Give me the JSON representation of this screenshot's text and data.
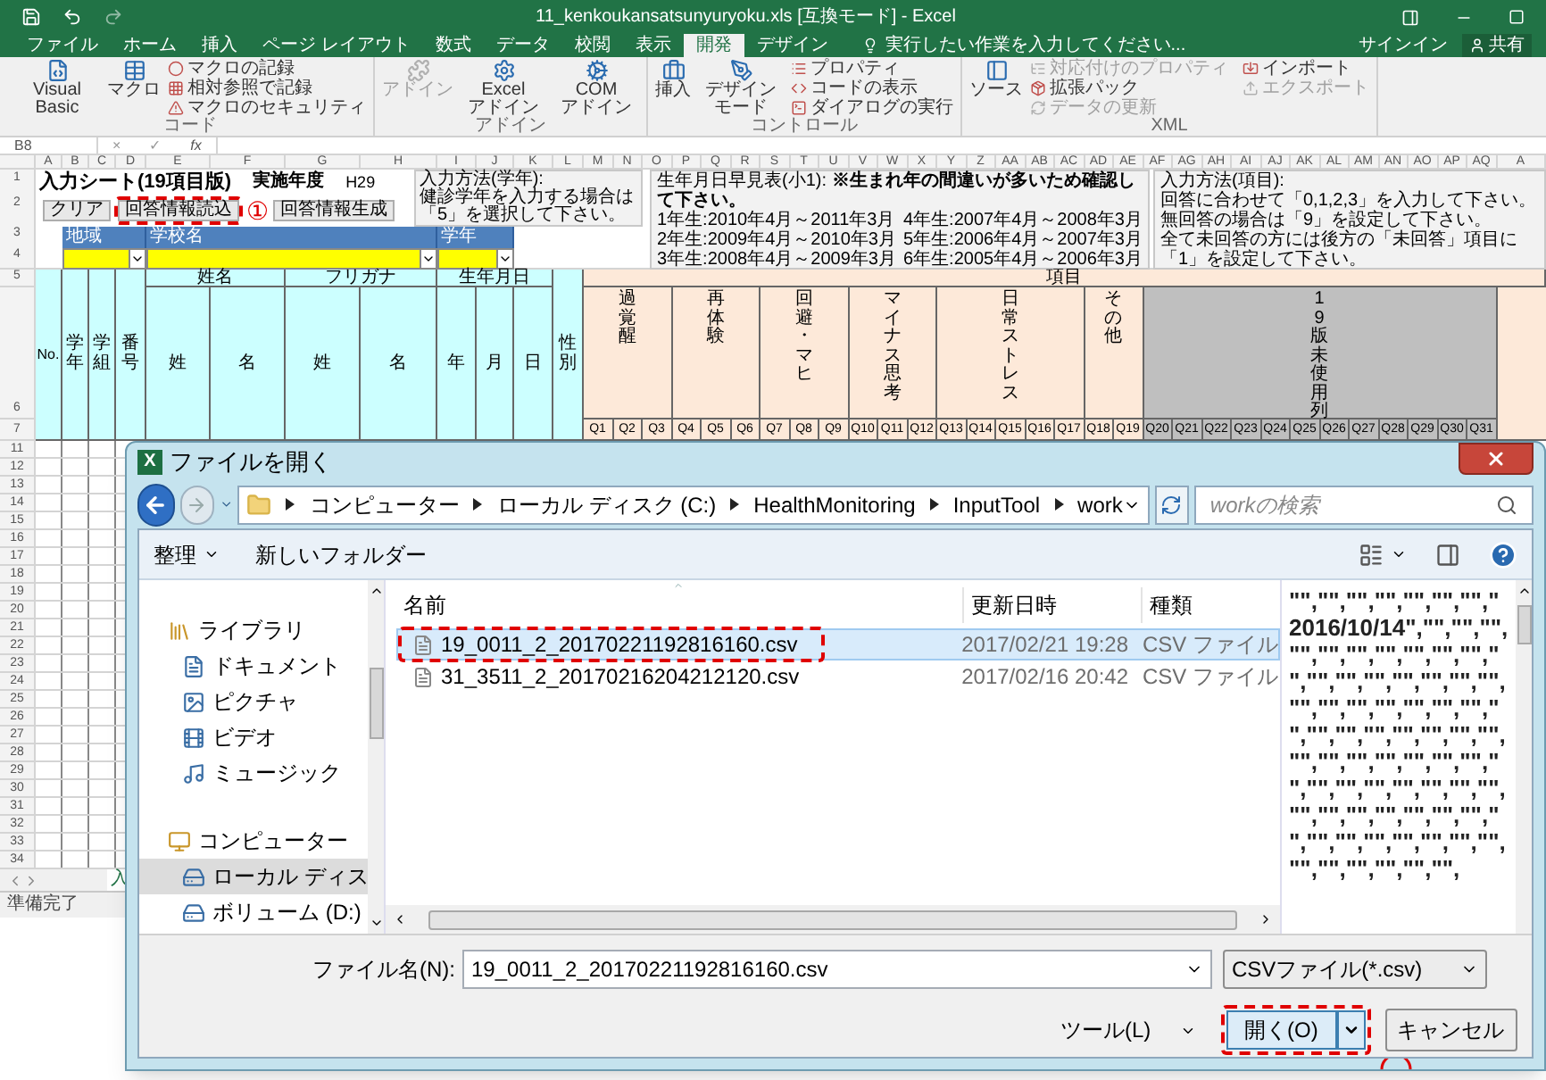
{
  "excel": {
    "title": "11_kenkoukansatsunyuryoku.xls [互換モード] - Excel",
    "tabs": [
      {
        "label": "ファイル",
        "selected": false
      },
      {
        "label": "ホーム",
        "selected": false
      },
      {
        "label": "挿入",
        "selected": false
      },
      {
        "label": "ページ レイアウト",
        "selected": false
      },
      {
        "label": "数式",
        "selected": false
      },
      {
        "label": "データ",
        "selected": false
      },
      {
        "label": "校閲",
        "selected": false
      },
      {
        "label": "表示",
        "selected": false
      },
      {
        "label": "開発",
        "selected": true
      },
      {
        "label": "デザイン",
        "selected": false
      }
    ],
    "tell_me": "実行したい作業を入力してください...",
    "sign_in": "サインイン",
    "share": "共有",
    "ribbon_groups": [
      {
        "label": "コード",
        "items": [
          {
            "kind": "large",
            "label": "Visual Basic",
            "disabled": false
          },
          {
            "kind": "large",
            "label": "マクロ",
            "disabled": false
          },
          {
            "kind": "small",
            "label": "マクロの記録",
            "disabled": false
          },
          {
            "kind": "small",
            "label": "相対参照で記録",
            "disabled": false
          },
          {
            "kind": "small",
            "label": "マクロのセキュリティ",
            "disabled": false
          }
        ]
      },
      {
        "label": "アドイン",
        "items": [
          {
            "kind": "large",
            "label": "アドイン",
            "disabled": true
          },
          {
            "kind": "large",
            "label": "Excel アドイン",
            "disabled": false
          },
          {
            "kind": "large",
            "label": "COM アドイン",
            "disabled": false
          }
        ]
      },
      {
        "label": "コントロール",
        "items": [
          {
            "kind": "large",
            "label": "挿入",
            "disabled": false
          },
          {
            "kind": "large",
            "label": "デザインモード",
            "disabled": false
          },
          {
            "kind": "small",
            "label": "プロパティ",
            "disabled": false
          },
          {
            "kind": "small",
            "label": "コードの表示",
            "disabled": false
          },
          {
            "kind": "small",
            "label": "ダイアログの実行",
            "disabled": false
          }
        ]
      },
      {
        "label": "XML",
        "items": [
          {
            "kind": "large",
            "label": "ソース",
            "disabled": false
          },
          {
            "kind": "small",
            "label": "対応付けのプロパティ",
            "disabled": true
          },
          {
            "kind": "small",
            "label": "拡張パック",
            "disabled": false
          },
          {
            "kind": "small",
            "label": "データの更新",
            "disabled": true
          },
          {
            "kind": "small",
            "label": "インポート",
            "disabled": false
          },
          {
            "kind": "small",
            "label": "エクスポート",
            "disabled": true
          }
        ]
      }
    ],
    "formula_bar": {
      "name_box": "B8",
      "cancel": "×",
      "enter": "✓",
      "function": "fx"
    },
    "columns": [
      "A",
      "B",
      "C",
      "D",
      "E",
      "F",
      "G",
      "H",
      "I",
      "J",
      "K",
      "L",
      "M",
      "N",
      "O",
      "P",
      "Q",
      "R",
      "S",
      "T",
      "U",
      "V",
      "W",
      "X",
      "Y",
      "Z",
      "AA",
      "AB",
      "AC",
      "AD",
      "AE",
      "AF",
      "AG",
      "AH",
      "AI",
      "AJ",
      "AK",
      "AL",
      "AM",
      "AN",
      "AO",
      "AP",
      "AQ",
      "A"
    ],
    "top_rows": [
      "1",
      "2",
      "3",
      "4"
    ],
    "sheet_title": "入力シート(19項目版)",
    "year_label": "実施年度",
    "year_value": "H29",
    "buttons": [
      {
        "label": "クリア",
        "highlighted": false
      },
      {
        "label": "回答情報読込",
        "highlighted": true
      },
      {
        "label": "回答情報生成",
        "highlighted": false
      }
    ],
    "step_mark": "①",
    "grade_note": [
      "入力方法(学年):",
      "健診学年を入力する場合は",
      "「5」を選択して下さい。"
    ],
    "birth_note": {
      "heading": "生年月日早見表(小1): **※生まれ年の間違いが多いため確認して下さい。**",
      "lines": [
        "1年生:2010年4月～2011年3月",
        "4年生:2007年4月～2008年3月",
        "2年生:2009年4月～2010年3月",
        "5年生:2006年4月～2007年3月",
        "3年生:2008年4月～2009年3月",
        "6年生:2005年4月～2006年3月"
      ]
    },
    "item_note": [
      "入力方法(項目):",
      "回答に合わせて「0,1,2,3」を入力して下さい。",
      "無回答の場合は「9」を設定して下さい。",
      "全て未回答の方には後方の「未回答」項目に",
      "「1」を設定して下さい。"
    ],
    "selectors": [
      {
        "label": "地域"
      },
      {
        "label": "学校名"
      },
      {
        "label": "学年"
      }
    ],
    "header_rows": [
      "5",
      "6",
      "7"
    ],
    "person_columns": [
      {
        "label": "No.",
        "kind": "horizontal"
      },
      {
        "label": "学年",
        "kind": "vertical"
      },
      {
        "label": "学組",
        "kind": "vertical"
      },
      {
        "label": "番号",
        "kind": "vertical"
      }
    ],
    "name_groups": [
      {
        "label": "姓名",
        "sub": [
          "姓",
          "名"
        ]
      },
      {
        "label": "フリガナ",
        "sub": [
          "姓",
          "名"
        ]
      },
      {
        "label": "生年月日",
        "sub": [
          "年",
          "月",
          "日"
        ]
      }
    ],
    "gender": "性別",
    "items_label": "項目",
    "item_groups": [
      {
        "label": "過覚醒",
        "unused": false,
        "questions": [
          "Q1",
          "Q2",
          "Q3"
        ]
      },
      {
        "label": "再体験",
        "unused": false,
        "questions": [
          "Q4",
          "Q5",
          "Q6"
        ]
      },
      {
        "label": "回避・マヒ",
        "unused": false,
        "questions": [
          "Q7",
          "Q8",
          "Q9"
        ]
      },
      {
        "label": "マイナス思考",
        "unused": false,
        "questions": [
          "Q10",
          "Q11",
          "Q12"
        ]
      },
      {
        "label": "日常ストレス",
        "unused": false,
        "questions": [
          "Q13",
          "Q14",
          "Q15",
          "Q16",
          "Q17"
        ]
      },
      {
        "label": "その他",
        "unused": false,
        "questions": [
          "Q18",
          "Q19"
        ]
      },
      {
        "label": "19版未使用列",
        "unused": true,
        "questions": [
          "Q20",
          "Q21",
          "Q22",
          "Q23",
          "Q24",
          "Q25",
          "Q26",
          "Q27",
          "Q28",
          "Q29",
          "Q30",
          "Q31"
        ]
      }
    ],
    "rows": [
      "11",
      "12",
      "13",
      "14",
      "15",
      "16",
      "17",
      "18",
      "19",
      "20",
      "21",
      "22",
      "23",
      "24",
      "25",
      "26",
      "27",
      "28",
      "29",
      "30",
      "31",
      "32",
      "33",
      "34"
    ],
    "sheet_tab": "入",
    "status": "準備完了"
  },
  "dialog": {
    "title": "ファイルを開く",
    "app_badge": "X",
    "path": [
      "コンピューター",
      "ローカル ディスク (C:)",
      "HealthMonitoring",
      "InputTool",
      "work"
    ],
    "search_placeholder": "workの検索",
    "organize": "整理",
    "new_folder": "新しいフォルダー",
    "nav": [
      {
        "label": "ライブラリ",
        "kind": "library",
        "selected": false,
        "children": [
          {
            "label": "ドキュメント",
            "kind": "documents",
            "selected": false
          },
          {
            "label": "ピクチャ",
            "kind": "pictures",
            "selected": false
          },
          {
            "label": "ビデオ",
            "kind": "videos",
            "selected": false
          },
          {
            "label": "ミュージック",
            "kind": "music",
            "selected": false
          }
        ]
      },
      {
        "label": "コンピューター",
        "kind": "computer",
        "selected": false,
        "children": [
          {
            "label": "ローカル ディス",
            "kind": "disk",
            "selected": true
          },
          {
            "label": "ボリューム (D:)",
            "kind": "drive",
            "selected": false
          }
        ]
      }
    ],
    "columns": [
      "名前",
      "更新日時",
      "種類"
    ],
    "files": [
      {
        "name": "19_0011_2_20170221192816160.csv",
        "modified": "2017/02/21 19:28",
        "type": "CSV ファイル",
        "selected": true,
        "highlighted": true
      },
      {
        "name": "31_3511_2_20170216204212120.csv",
        "modified": "2017/02/16 20:42",
        "type": "CSV ファイル",
        "selected": false,
        "highlighted": false
      }
    ],
    "preview": "\"\",\"\",\"\",\"\",\"\",\"\",\"\",\"2016/10/14\",\"\",\"\",\"\",\"\",\"\",\"\",\"\",\"\",\"\",\"\",\"\",\"\",\"\",\"\",\"\",\"\",\"\",\"\",\"\",\"\",\"\",\"\",\"\",\"\",\"\",\"\",\"\",\"\",\"\",\"\",\"\",\"\",\"\",\"\",\"\",\"\",\"\",\"\",\"\",\"\",\"\",\"\",\"\",\"\",\"\",\"\",\"\",\"\",\"\",\"\",\"\",\"\",\"\",\"\",\"\",\"\",\"\",\"\",\"\",\"\",\"\",\"\",\"\",\"\",\"\",\"\",\"\",\"\",\"\",",
    "file_name_label": "ファイル名(N):",
    "file_name": "19_0011_2_20170221192816160.csv",
    "file_type": "CSVファイル(*.csv)",
    "tools": "ツール(L)",
    "open": {
      "label": "開く(O)",
      "highlighted": true
    },
    "cancel": "キャンセル"
  }
}
